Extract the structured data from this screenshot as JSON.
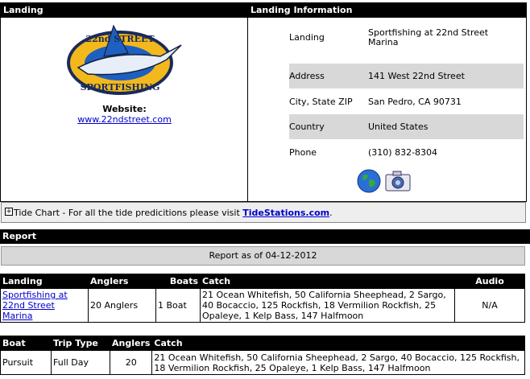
{
  "landing_panel": {
    "header": "Landing",
    "logo_top_text": "22nd STREET",
    "logo_bottom_text": "SPORTFISHING",
    "website_label": "Website:",
    "website_url": "www.22ndstreet.com"
  },
  "info_panel": {
    "header": "Landing Information",
    "rows": [
      {
        "key": "Landing",
        "value": "Sportfishing at 22nd Street Marina"
      },
      {
        "key": "Address",
        "value": "141 West 22nd Street"
      },
      {
        "key": "City, State ZIP",
        "value": "San Pedro, CA 90731"
      },
      {
        "key": "Country",
        "value": "United States"
      },
      {
        "key": "Phone",
        "value": "(310) 832-8304"
      }
    ],
    "icons": [
      "globe-icon",
      "camera-icon"
    ]
  },
  "tide": {
    "toggle": "+",
    "text": "Tide Chart - For all the tide predicitions please visit ",
    "link": "TideStations.com",
    "suffix": "."
  },
  "report": {
    "header": "Report",
    "as_of": "Report as of 04-12-2012",
    "summary_table": {
      "headers": [
        "Landing",
        "Anglers",
        "Boats",
        "Catch",
        "Audio"
      ],
      "row": {
        "landing": "Sportfishing at 22nd Street Marina",
        "anglers": "20 Anglers",
        "boats": "1 Boat",
        "catch": "21 Ocean Whitefish, 50 California Sheephead, 2 Sargo, 40 Bocaccio, 125 Rockfish, 18 Vermilion Rockfish, 25 Opaleye, 1 Kelp Bass, 147 Halfmoon",
        "audio": "N/A"
      }
    },
    "boat_table": {
      "headers": [
        "Boat",
        "Trip Type",
        "Anglers",
        "Catch"
      ],
      "row": {
        "boat": "Pursuit",
        "trip_type": "Full Day",
        "anglers": "20",
        "catch": "21 Ocean Whitefish, 50 California Sheephead, 2 Sargo, 40 Bocaccio, 125 Rockfish, 18 Vermilion Rockfish, 25 Opaleye, 1 Kelp Bass, 147 Halfmoon"
      }
    }
  }
}
